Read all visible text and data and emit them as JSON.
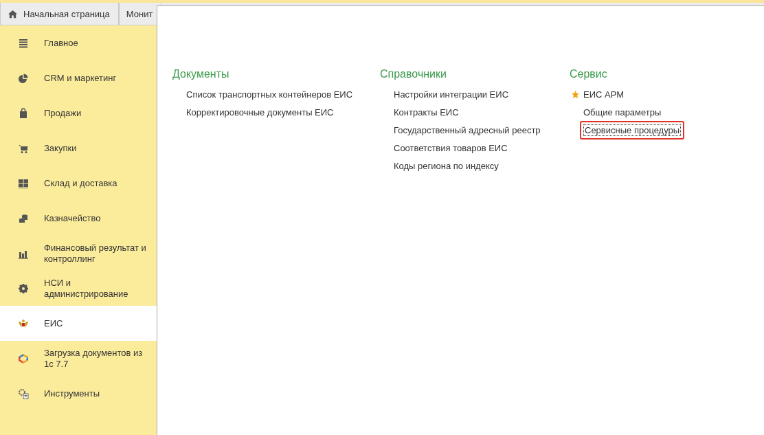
{
  "tabs": [
    {
      "label": "Начальная страница",
      "kind": "home",
      "selected": false
    },
    {
      "label": "Монит",
      "kind": "plain",
      "selected": false
    }
  ],
  "sidebar": {
    "items": [
      {
        "label": "Главное",
        "selected": false
      },
      {
        "label": "CRM и маркетинг",
        "selected": false
      },
      {
        "label": "Продажи",
        "selected": false
      },
      {
        "label": "Закупки",
        "selected": false
      },
      {
        "label": "Склад и доставка",
        "selected": false
      },
      {
        "label": "Казначейство",
        "selected": false
      },
      {
        "label": "Финансовый результат и контроллинг",
        "selected": false
      },
      {
        "label": "НСИ и администрирование",
        "selected": false
      },
      {
        "label": "ЕИС",
        "selected": true
      },
      {
        "label": "Загрузка документов из 1с 7.7",
        "selected": false
      },
      {
        "label": "Инструменты",
        "selected": false
      }
    ]
  },
  "sections": [
    {
      "title": "Документы",
      "items": [
        {
          "label": "Список транспортных контейнеров ЕИС",
          "favorite": false,
          "highlighted": false
        },
        {
          "label": "Корректировочные документы ЕИС",
          "favorite": false,
          "highlighted": false
        }
      ]
    },
    {
      "title": "Справочники",
      "items": [
        {
          "label": "Настройки интеграции ЕИС",
          "favorite": false,
          "highlighted": false
        },
        {
          "label": "Контракты ЕИС",
          "favorite": false,
          "highlighted": false
        },
        {
          "label": "Государственный адресный реестр",
          "favorite": false,
          "highlighted": false
        },
        {
          "label": "Соответствия товаров ЕИС",
          "favorite": false,
          "highlighted": false
        },
        {
          "label": "Коды региона по индексу",
          "favorite": false,
          "highlighted": false
        }
      ]
    },
    {
      "title": "Сервис",
      "items": [
        {
          "label": "ЕИС АРМ",
          "favorite": true,
          "highlighted": false
        },
        {
          "label": "Общие параметры",
          "favorite": false,
          "highlighted": false
        },
        {
          "label": "Сервисные процедуры",
          "favorite": false,
          "highlighted": true
        }
      ]
    }
  ]
}
